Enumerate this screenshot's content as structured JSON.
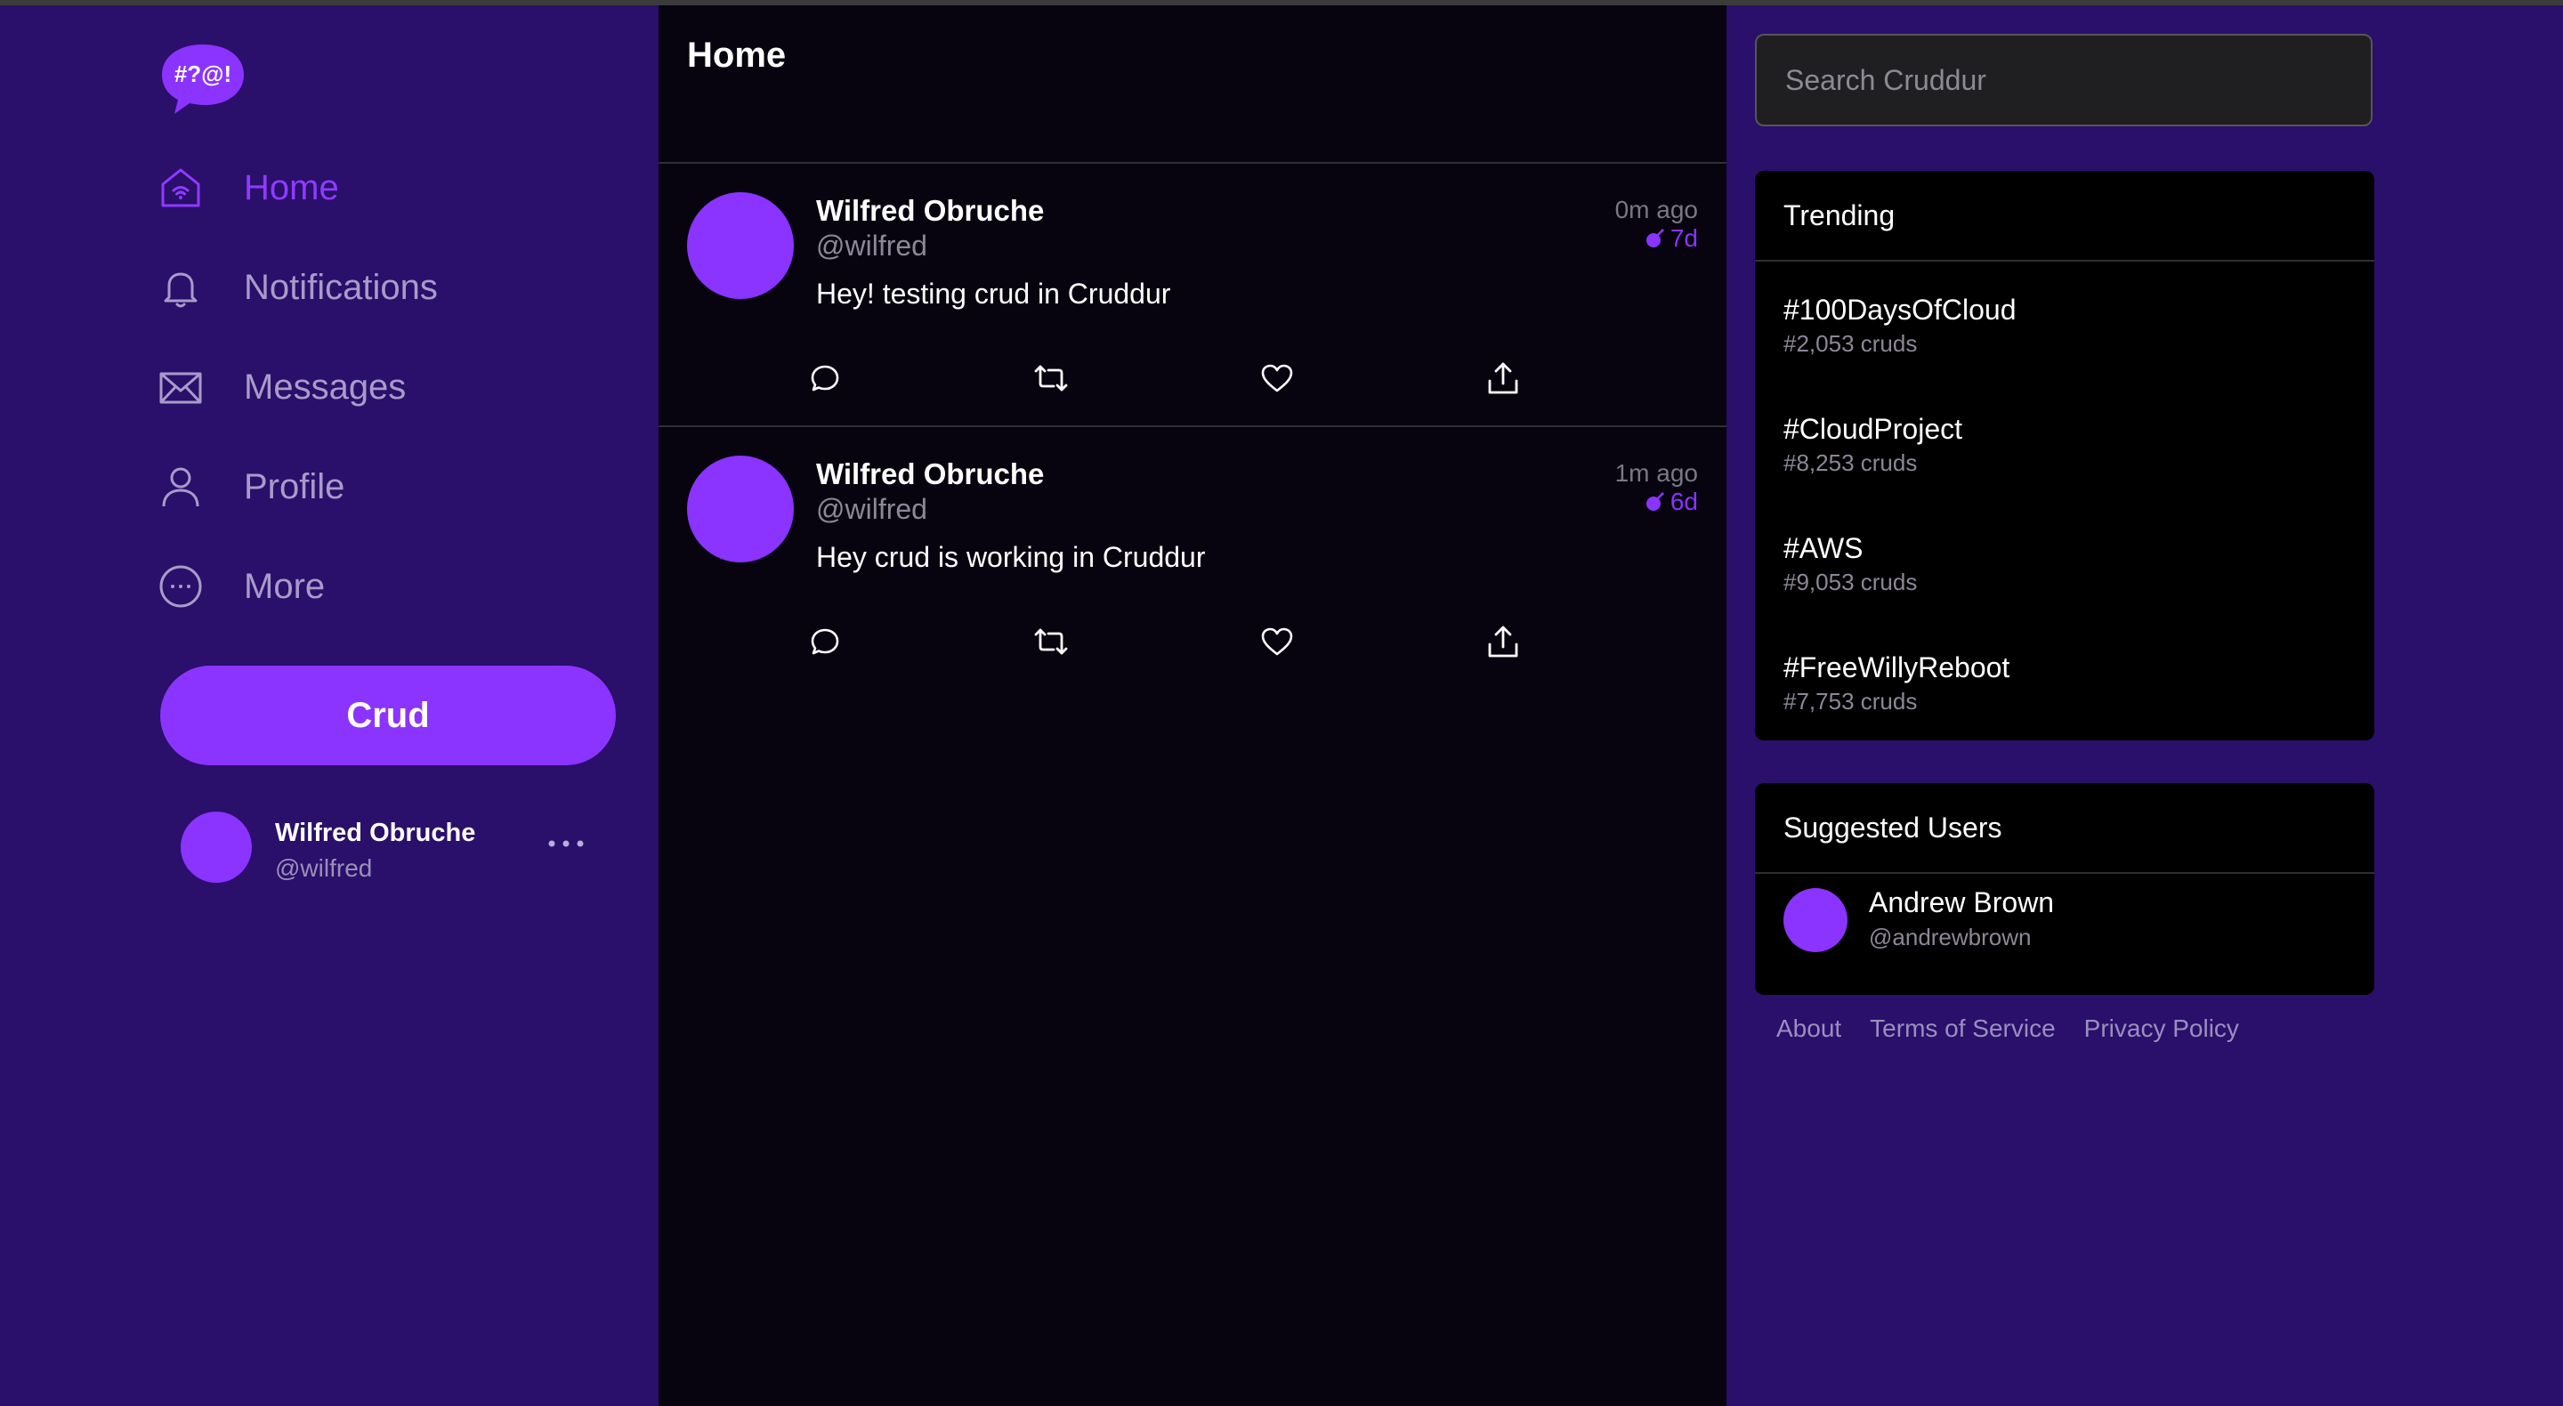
{
  "app": {
    "logo_text": "#?@!",
    "brand_color": "#8b33ff",
    "sidebar_bg": "#2a0f6b",
    "feed_bg": "#07040f"
  },
  "sidebar": {
    "items": [
      {
        "label": "Home",
        "icon": "home-icon",
        "active": true
      },
      {
        "label": "Notifications",
        "icon": "bell-icon",
        "active": false
      },
      {
        "label": "Messages",
        "icon": "envelope-icon",
        "active": false
      },
      {
        "label": "Profile",
        "icon": "person-icon",
        "active": false
      },
      {
        "label": "More",
        "icon": "more-circle-icon",
        "active": false
      }
    ],
    "crud_button": "Crud",
    "user": {
      "name": "Wilfred Obruche",
      "handle": "@wilfred",
      "more_icon": "ellipsis-icon"
    }
  },
  "feed": {
    "title": "Home",
    "posts": [
      {
        "author": "Wilfred Obruche",
        "handle": "@wilfred",
        "text": "Hey! testing crud in Cruddur",
        "time": "0m ago",
        "expires": "7d"
      },
      {
        "author": "Wilfred Obruche",
        "handle": "@wilfred",
        "text": "Hey crud is working in Cruddur",
        "time": "1m ago",
        "expires": "6d"
      }
    ],
    "action_icons": [
      "reply-icon",
      "repost-icon",
      "like-icon",
      "share-icon"
    ]
  },
  "right": {
    "search_placeholder": "Search Cruddur",
    "trending": {
      "title": "Trending",
      "items": [
        {
          "tag": "#100DaysOfCloud",
          "count": "#2,053 cruds"
        },
        {
          "tag": "#CloudProject",
          "count": "#8,253 cruds"
        },
        {
          "tag": "#AWS",
          "count": "#9,053 cruds"
        },
        {
          "tag": "#FreeWillyReboot",
          "count": "#7,753 cruds"
        }
      ]
    },
    "suggested": {
      "title": "Suggested Users",
      "users": [
        {
          "name": "Andrew Brown",
          "handle": "@andrewbrown"
        }
      ]
    },
    "footer": [
      "About",
      "Terms of Service",
      "Privacy Policy"
    ]
  }
}
